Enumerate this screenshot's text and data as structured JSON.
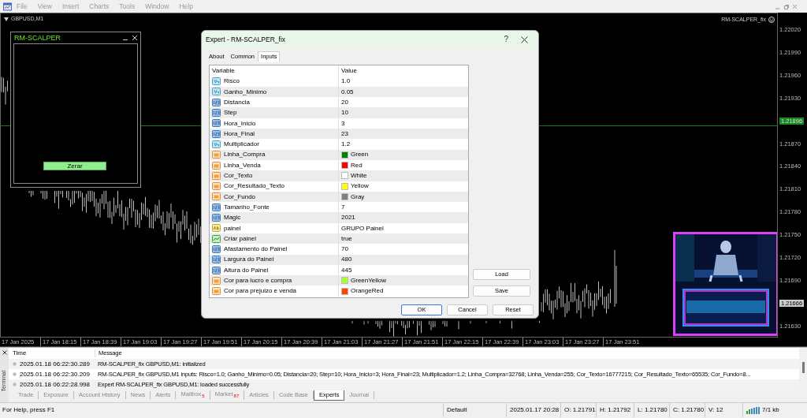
{
  "menu": [
    "File",
    "View",
    "Insert",
    "Charts",
    "Tools",
    "Window",
    "Help"
  ],
  "chart": {
    "symbol": "GBPUSD,M1",
    "expert_label": "RM-SCALPER_fix",
    "price_axis": [
      {
        "label": "1.22020",
        "kind": "tick"
      },
      {
        "label": "1.21990",
        "kind": "tick"
      },
      {
        "label": "1.21960",
        "kind": "tick"
      },
      {
        "label": "1.21930",
        "kind": "tick"
      },
      {
        "label": "1.21896",
        "kind": "bid"
      },
      {
        "label": "1.21870",
        "kind": "tick"
      },
      {
        "label": "1.21840",
        "kind": "tick"
      },
      {
        "label": "1.21810",
        "kind": "tick"
      },
      {
        "label": "1.21780",
        "kind": "tick"
      },
      {
        "label": "1.21750",
        "kind": "tick"
      },
      {
        "label": "1.21720",
        "kind": "tick"
      },
      {
        "label": "1.21690",
        "kind": "tick"
      },
      {
        "label": "1.21666",
        "kind": "last"
      },
      {
        "label": "1.21630",
        "kind": "tick"
      }
    ],
    "time_axis": [
      "17 Jan 2025",
      "17 Jan 18:15",
      "17 Jan 18:39",
      "17 Jan 19:03",
      "17 Jan 19:27",
      "17 Jan 19:51",
      "17 Jan 20:15",
      "17 Jan 20:39",
      "17 Jan 21:03",
      "17 Jan 21:27",
      "17 Jan 21:51",
      "17 Jan 22:15",
      "17 Jan 22:39",
      "17 Jan 23:03",
      "17 Jan 23:27",
      "17 Jan 23:51"
    ]
  },
  "panel": {
    "title": "RM-SCALPER",
    "button": "Zerar"
  },
  "dialog": {
    "title": "Expert - RM-SCALPER_fix",
    "help_button": "?",
    "tabs": [
      {
        "label": "About",
        "selected": false
      },
      {
        "label": "Common",
        "selected": false
      },
      {
        "label": "Inputs",
        "selected": true
      }
    ],
    "columns": [
      "Variable",
      "Value"
    ],
    "inputs": [
      {
        "kind": "double",
        "name": "Risco",
        "value": "1.0"
      },
      {
        "kind": "double",
        "name": "Ganho_Minimo",
        "value": "0.05"
      },
      {
        "kind": "int",
        "name": "Distancia",
        "value": "20"
      },
      {
        "kind": "int",
        "name": "Step",
        "value": "10"
      },
      {
        "kind": "int",
        "name": "Hora_Inicio",
        "value": "3"
      },
      {
        "kind": "int",
        "name": "Hora_Final",
        "value": "23"
      },
      {
        "kind": "double",
        "name": "Multiplicador",
        "value": "1.2"
      },
      {
        "kind": "color",
        "name": "Linha_Compra",
        "value": "Green",
        "color": "#008000"
      },
      {
        "kind": "color",
        "name": "Linha_Venda",
        "value": "Red",
        "color": "#ff0000"
      },
      {
        "kind": "color",
        "name": "Cor_Texto",
        "value": "White",
        "color": "#ffffff"
      },
      {
        "kind": "color",
        "name": "Cor_Resultado_Texto",
        "value": "Yellow",
        "color": "#ffff00"
      },
      {
        "kind": "color",
        "name": "Cor_Fundo",
        "value": "Gray",
        "color": "#808080"
      },
      {
        "kind": "int",
        "name": "Tamanho_Fonte",
        "value": "7"
      },
      {
        "kind": "int",
        "name": "Magic",
        "value": "2021"
      },
      {
        "kind": "string",
        "name": "painel",
        "value": "GRUPO Painel"
      },
      {
        "kind": "bool",
        "name": "Criar painel",
        "value": "true"
      },
      {
        "kind": "int",
        "name": "Afastamento do Painel",
        "value": "70"
      },
      {
        "kind": "int",
        "name": "Largura do Painel",
        "value": "480"
      },
      {
        "kind": "int",
        "name": "Altura do Painel",
        "value": "445"
      },
      {
        "kind": "color",
        "name": "Cor para lucro e compra",
        "value": "GreenYellow",
        "color": "#adff2f"
      },
      {
        "kind": "color",
        "name": "Cor para prejuizo e venda",
        "value": "OrangeRed",
        "color": "#ff4500"
      }
    ],
    "side_buttons": [
      "Load",
      "Save"
    ],
    "buttons": [
      {
        "label": "OK",
        "default": true
      },
      {
        "label": "Cancel",
        "default": false
      },
      {
        "label": "Reset",
        "default": false
      }
    ]
  },
  "terminal": {
    "title": "Terminal",
    "columns": [
      "Time",
      "Message"
    ],
    "rows": [
      {
        "time": "2025.01.18 06:22:30.289",
        "message": "RM-SCALPER_fix GBPUSD,M1: initialized"
      },
      {
        "time": "2025.01.18 06:22:30.209",
        "message": "RM-SCALPER_fix GBPUSD,M1 inputs: Risco=1.0; Ganho_Minimo=0.05; Distancia=20; Step=10; Hora_Inicio=3; Hora_Final=23; Multiplicador=1.2; Linha_Compra=32768; Linha_Venda=255; Cor_Texto=16777215; Cor_Resultado_Texto=65535; Cor_Fundo=8..."
      },
      {
        "time": "2025.01.18 06:22:28.998",
        "message": "Expert RM-SCALPER_fix GBPUSD,M1: loaded successfully"
      }
    ],
    "tabs": [
      {
        "label": "Trade",
        "selected": false
      },
      {
        "label": "Exposure",
        "selected": false
      },
      {
        "label": "Account History",
        "selected": false
      },
      {
        "label": "News",
        "selected": false
      },
      {
        "label": "Alerts",
        "selected": false
      },
      {
        "label": "Mailbox",
        "badge": "5",
        "selected": false
      },
      {
        "label": "Market",
        "badge": "87",
        "selected": false
      },
      {
        "label": "Articles",
        "selected": false
      },
      {
        "label": "Code Base",
        "selected": false
      },
      {
        "label": "Experts",
        "selected": true
      },
      {
        "label": "Journal",
        "selected": false
      }
    ]
  },
  "status_bar": {
    "help": "For Help, press F1",
    "profile": "Default",
    "datetime": "2025.01.17 20:28",
    "open": "O: 1.21791",
    "high": "H: 1.21792",
    "low": "L: 1.21780",
    "close": "C: 1.21780",
    "volume": "V: 12",
    "traffic": "7/1 kb"
  }
}
